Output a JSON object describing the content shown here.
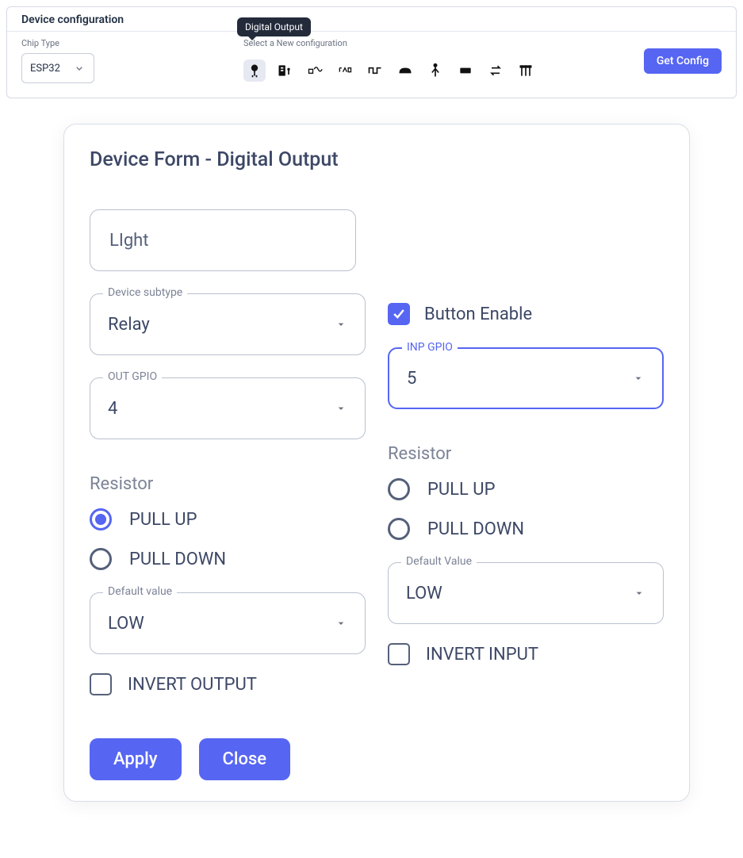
{
  "top": {
    "title": "Device configuration",
    "chip_label": "Chip Type",
    "chip_value": "ESP32",
    "select_label": "Select a New configuration",
    "tooltip": "Digital Output",
    "icons": [
      "digital-output-icon",
      "interface-icon",
      "analog-in-icon",
      "uart-icon",
      "square-wave-icon",
      "curve-icon",
      "fork-icon",
      "bus-icon",
      "swap-icon",
      "header-pins-icon"
    ],
    "get_config": "Get Config"
  },
  "form": {
    "title": "Device Form - Digital Output",
    "name_value": "LIght",
    "subtype_label": "Device subtype",
    "subtype_value": "Relay",
    "button_enable_label": "Button Enable",
    "button_enable_checked": true,
    "out_gpio_label": "OUT GPIO",
    "out_gpio_value": "4",
    "inp_gpio_label": "INP GPIO",
    "inp_gpio_value": "5",
    "resistor_header": "Resistor",
    "pull_up": "PULL UP",
    "pull_down": "PULL DOWN",
    "out_resistor_selected": "PULL UP",
    "inp_resistor_selected": "",
    "default_value_label_out": "Default value",
    "default_value_label_inp": "Default Value",
    "default_value_out": "LOW",
    "default_value_inp": "LOW",
    "invert_output": "INVERT OUTPUT",
    "invert_input": "INVERT INPUT",
    "invert_output_checked": false,
    "invert_input_checked": false,
    "apply": "Apply",
    "close": "Close"
  }
}
